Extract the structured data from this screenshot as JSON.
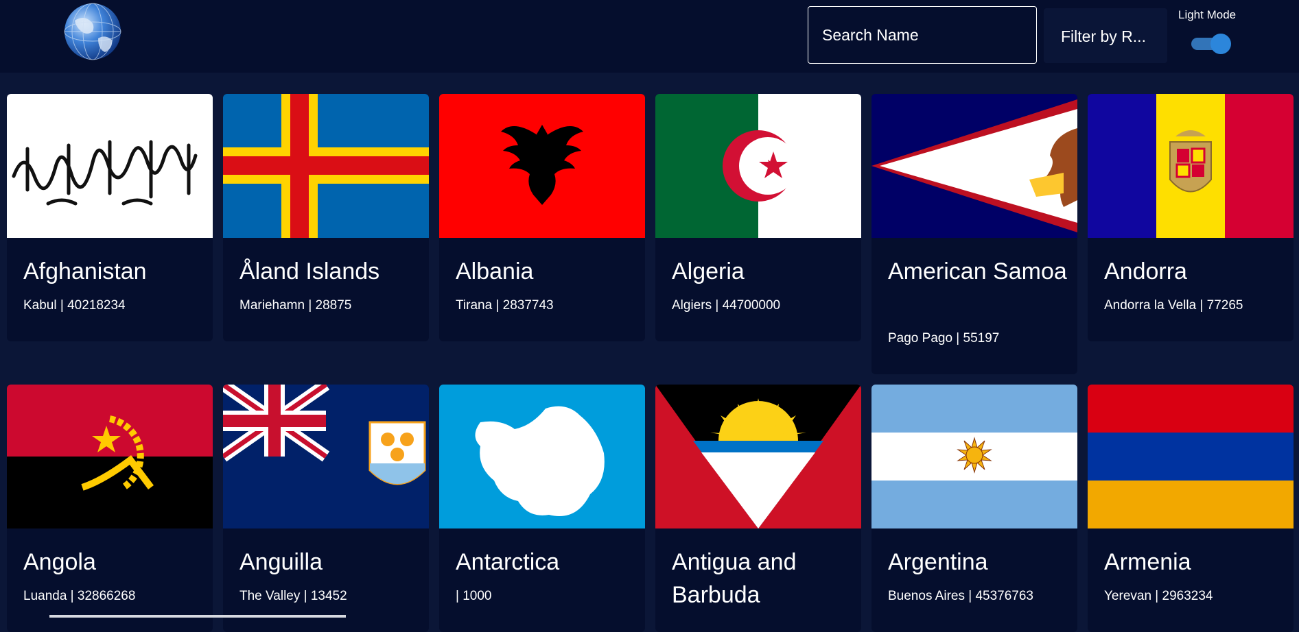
{
  "header": {
    "logo_icon": "globe-icon",
    "search_placeholder": "Search Name",
    "filter_label": "Filter by R...",
    "mode_label": "Light Mode",
    "mode_toggle_on": true
  },
  "countries": [
    {
      "name": "Afghanistan",
      "info": "Kabul | 40218234",
      "flag_icon": "afghanistan-flag-icon"
    },
    {
      "name": "Åland Islands",
      "info": "Mariehamn | 28875",
      "flag_icon": "aland-islands-flag-icon"
    },
    {
      "name": "Albania",
      "info": "Tirana | 2837743",
      "flag_icon": "albania-flag-icon"
    },
    {
      "name": "Algeria",
      "info": "Algiers | 44700000",
      "flag_icon": "algeria-flag-icon"
    },
    {
      "name": "American Samoa",
      "info": "Pago Pago | 55197",
      "flag_icon": "american-samoa-flag-icon"
    },
    {
      "name": "Andorra",
      "info": "Andorra la Vella | 77265",
      "flag_icon": "andorra-flag-icon"
    },
    {
      "name": "Angola",
      "info": "Luanda | 32866268",
      "flag_icon": "angola-flag-icon"
    },
    {
      "name": "Anguilla",
      "info": "The Valley | 13452",
      "flag_icon": "anguilla-flag-icon"
    },
    {
      "name": "Antarctica",
      "info": "| 1000",
      "flag_icon": "antarctica-flag-icon"
    },
    {
      "name": "Antigua and Barbuda",
      "info": "",
      "flag_icon": "antigua-and-barbuda-flag-icon"
    },
    {
      "name": "Argentina",
      "info": "Buenos Aires | 45376763",
      "flag_icon": "argentina-flag-icon"
    },
    {
      "name": "Armenia",
      "info": "Yerevan | 2963234",
      "flag_icon": "armenia-flag-icon"
    }
  ],
  "colors": {
    "page_background": "#0b1637",
    "card_background": "#050e2d",
    "toggle_accent": "#2c86db"
  }
}
